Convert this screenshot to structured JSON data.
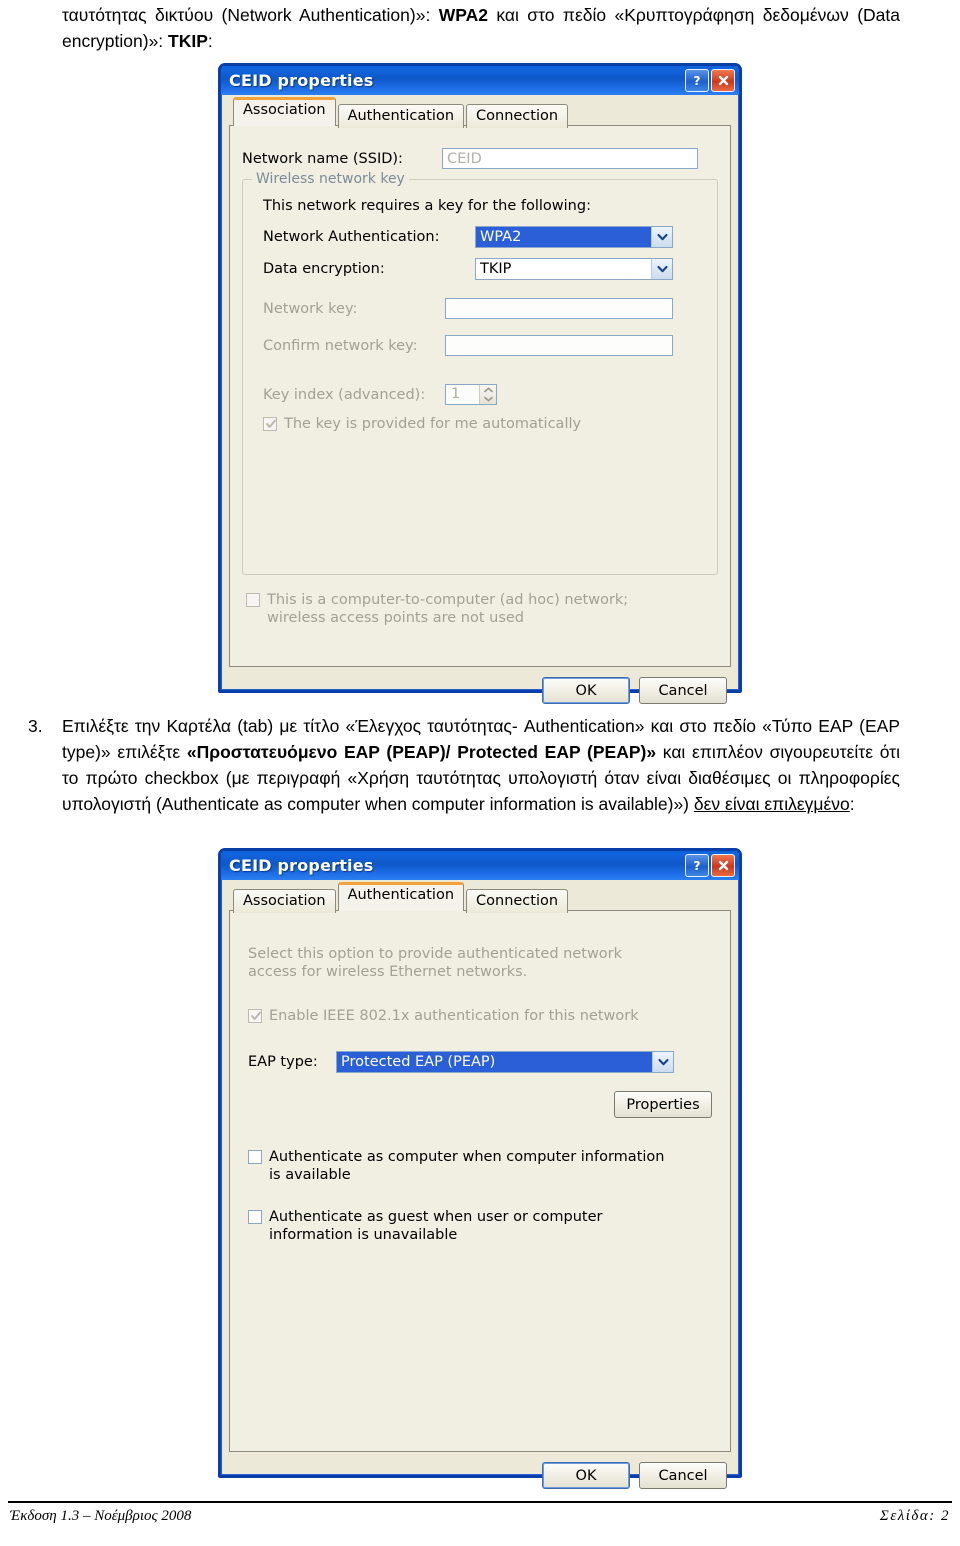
{
  "document": {
    "intro_paragraph": {
      "part1": "ταυτότητας δικτύου (Network Authentication)»: ",
      "bold1": "WPA2",
      "part2": " και στο πεδίο «Κρυπτογράφηση δεδομένων (Data encryption)»: ",
      "bold2": "TKIP",
      "part3": ":"
    },
    "step3": {
      "number": "3.",
      "part1": "Επιλέξτε την Καρτέλα (tab) με τίτλο «Έλεγχος ταυτότητας- Authentication» και στο πεδίο «Τύπο EAP (EAP type)» επιλέξτε ",
      "bold1": "«Προστατευόμενο EAP (PEAP)/ Protected EAP (PEAP)»",
      "part2": " και επιπλέον σιγουρευτείτε ότι το πρώτο checkbox (με περιγραφή «Χρήση ταυτότητας υπολογιστή όταν είναι διαθέσιμες οι πληροφορίες υπολογιστή (Authenticate as computer when computer information is available)») ",
      "underline": "δεν είναι επιλεγμένο",
      "part3": ":"
    },
    "footer": {
      "left": "Έκδοση 1.3 – Νοέμβριος 2008",
      "right": "Σελίδα:  2"
    }
  },
  "dialog1": {
    "title": "CEID properties",
    "help_glyph": "?",
    "close_glyph": "✕",
    "tabs": [
      {
        "label": "Association",
        "active": true
      },
      {
        "label": "Authentication",
        "active": false
      },
      {
        "label": "Connection",
        "active": false
      }
    ],
    "ssid_label": "Network name (SSID):",
    "ssid_value": "CEID",
    "groupbox_title": "Wireless network key",
    "group_intro": "This network requires a key for the following:",
    "network_auth_label": "Network Authentication:",
    "network_auth_value": "WPA2",
    "data_encryption_label": "Data encryption:",
    "data_encryption_value": "TKIP",
    "network_key_label": "Network key:",
    "network_key_value": "",
    "confirm_key_label": "Confirm network key:",
    "confirm_key_value": "",
    "key_index_label": "Key index (advanced):",
    "key_index_value": "1",
    "key_auto_label": "The key is provided for me automatically",
    "adhoc_label": "This is a computer-to-computer (ad hoc) network; wireless access points are not used",
    "ok_label": "OK",
    "cancel_label": "Cancel"
  },
  "dialog2": {
    "title": "CEID properties",
    "help_glyph": "?",
    "close_glyph": "✕",
    "tabs": [
      {
        "label": "Association",
        "active": false
      },
      {
        "label": "Authentication",
        "active": true
      },
      {
        "label": "Connection",
        "active": false
      }
    ],
    "intro_text": "Select this option to provide authenticated network access for wireless Ethernet networks.",
    "enable_8021x_label": "Enable IEEE 802.1x authentication for this network",
    "eap_type_label": "EAP type:",
    "eap_type_value": "Protected EAP (PEAP)",
    "properties_label": "Properties",
    "auth_computer_label": "Authenticate as computer when computer information is available",
    "auth_guest_label": "Authenticate as guest when user or computer information is unavailable",
    "ok_label": "OK",
    "cancel_label": "Cancel"
  },
  "colors": {
    "titlebar_blue": "#0e58c8",
    "dialog_border": "#0b3fa8",
    "dialog_face": "#ece9d8",
    "tab_active_accent": "#f2a33c",
    "selection_blue": "#2a5fd8",
    "close_red": "#d0351a"
  }
}
